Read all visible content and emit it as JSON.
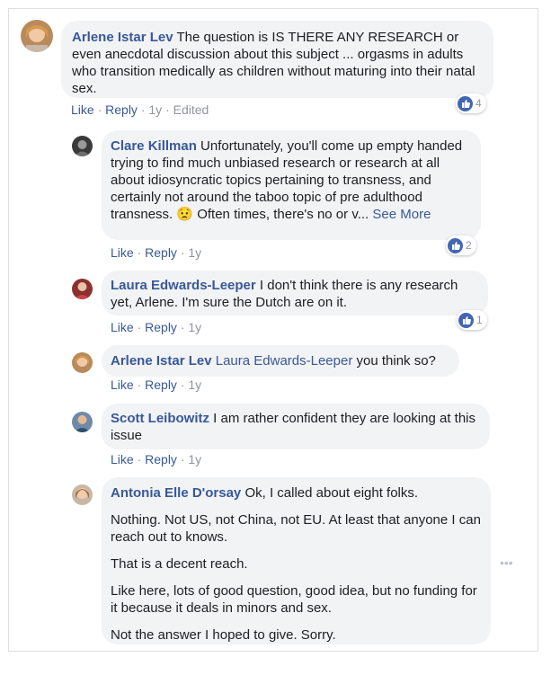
{
  "comments": [
    {
      "author": "Arlene Istar Lev",
      "text": " The question is IS THERE ANY RESEARCH or even anecdotal discussion about this subject ... orgasms in adults who transition medically as children without maturing into their natal sex.",
      "like": "Like",
      "reply": "Reply",
      "time": "1y",
      "edited": "Edited",
      "reactions": "4"
    },
    {
      "author": "Clare Killman",
      "text": " Unfortunately, you'll come up empty handed trying to find much unbiased research or research at all about idiosyncratic topics pertaining to transness, and certainly not around the taboo topic of pre adulthood transness. 😟 Often times, there's no or v...",
      "see_more": "See More",
      "like": "Like",
      "reply": "Reply",
      "time": "1y",
      "reactions": "2"
    },
    {
      "author": "Laura Edwards-Leeper",
      "text": " I don't think there is any research yet, Arlene. I'm sure the Dutch are on it.",
      "like": "Like",
      "reply": "Reply",
      "time": "1y",
      "reactions": "1"
    },
    {
      "author": "Arlene Istar Lev",
      "mention": "Laura Edwards-Leeper",
      "text": " you think so?",
      "like": "Like",
      "reply": "Reply",
      "time": "1y"
    },
    {
      "author": "Scott Leibowitz",
      "text": " I am rather confident they are looking at this issue",
      "like": "Like",
      "reply": "Reply",
      "time": "1y"
    },
    {
      "author": "Antonia Elle D'orsay",
      "text": " Ok, I called about eight folks.",
      "paragraphs": [
        "Nothing. Not US, not China, not EU. At least that anyone I can reach out to knows.",
        "That is a decent reach.",
        "Like here, lots of good question, good idea, but no funding for it because it deals in minors and sex.",
        "Not the answer I hoped to give. Sorry."
      ]
    }
  ],
  "more_icon": "ellipsis-icon",
  "more_glyph": "•••",
  "colors": {
    "link_blue": "#385898",
    "bubble_bg": "#f2f3f5",
    "meta_gray": "#90949c",
    "like_blue": "#4267b2"
  }
}
